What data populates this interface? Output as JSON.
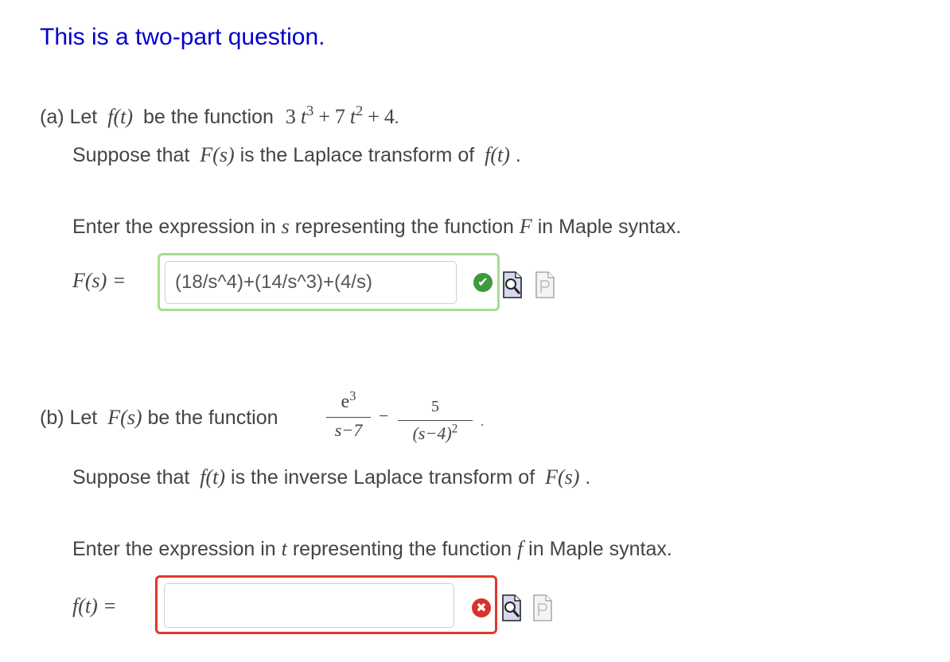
{
  "header": {
    "title": "This is a two-part question."
  },
  "part_a": {
    "label": "(a) Let",
    "f_of_t": "f(t)",
    "be_the_function": "be the function",
    "function_expr": {
      "c1": "3",
      "v1": "t",
      "e1": "3",
      "op1": "+",
      "c2": "7",
      "v2": "t",
      "e2": "2",
      "op2": "+",
      "c3": "4",
      "end": "."
    },
    "suppose_prefix": "Suppose that",
    "F_of_s": "F(s)",
    "suppose_middle": "is the Laplace transform of",
    "f_of_t2": "f(t)",
    "suppose_end": ".",
    "enter_prefix": "Enter the expression in",
    "var": "s",
    "enter_middle": "representing the function",
    "func_name": "F",
    "enter_suffix": "in Maple syntax.",
    "answer_label": "F(s) =",
    "answer_value": "(18/s^4)+(14/s^3)+(4/s)",
    "status": "correct",
    "status_color": "#3d9a3d",
    "border_color": "#a6de8e"
  },
  "part_b": {
    "label": "(b) Let",
    "F_of_s": "F(s)",
    "be_the_function": "be the function",
    "frac1": {
      "numerator": "e",
      "num_exp": "3",
      "denominator": "s−7"
    },
    "minus": "−",
    "frac2": {
      "numerator": "5",
      "denominator": "(s−4)",
      "den_exp": "2"
    },
    "end": ".",
    "suppose_prefix": "Suppose that",
    "f_of_t": "f(t)",
    "suppose_middle": "is the inverse Laplace transform of",
    "F_of_s2": "F(s)",
    "suppose_end": ".",
    "enter_prefix": "Enter the expression in",
    "var": "t",
    "enter_middle": "representing the function",
    "func_name": "f",
    "enter_suffix": "in Maple syntax.",
    "answer_label": "f(t) =",
    "answer_value": "",
    "status": "incorrect",
    "status_color": "#d8322a",
    "border_color": "#e0382b"
  },
  "icons": {
    "status_ok": "✔",
    "status_bad": "✖",
    "preview": "preview-icon",
    "plain": "plain-text-icon"
  }
}
